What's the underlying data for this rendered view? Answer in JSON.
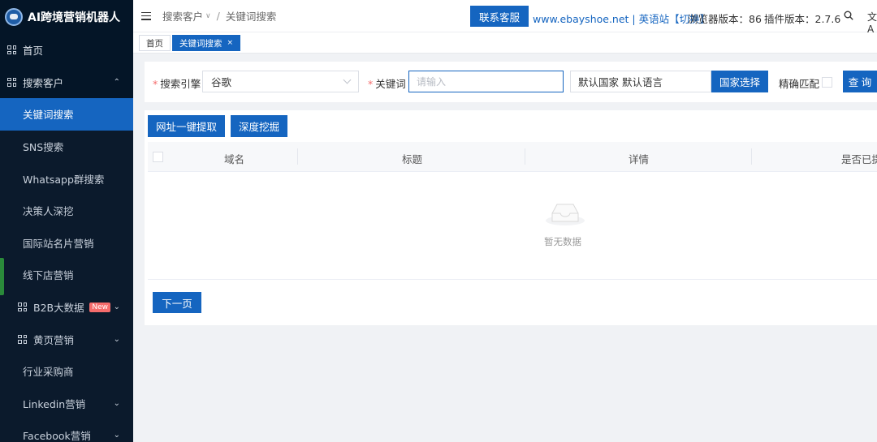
{
  "app": {
    "title": "AI跨境营销机器人"
  },
  "sidebar": {
    "items": [
      {
        "label": "首页",
        "icon": "grid-icon",
        "level": "top"
      },
      {
        "label": "搜索客户",
        "icon": "grid-icon",
        "level": "top",
        "expanded": true
      },
      {
        "label": "关键词搜索",
        "level": "sub",
        "active": true
      },
      {
        "label": "SNS搜索",
        "level": "sub"
      },
      {
        "label": "Whatsapp群搜索",
        "level": "sub"
      },
      {
        "label": "决策人深挖",
        "level": "sub"
      },
      {
        "label": "国际站名片营销",
        "level": "sub"
      },
      {
        "label": "线下店营销",
        "level": "sub"
      },
      {
        "label": "B2B大数据",
        "icon": "grid-icon",
        "level": "sub",
        "badge": "New"
      },
      {
        "label": "黄页营销",
        "icon": "grid-icon",
        "level": "sub"
      },
      {
        "label": "行业采购商",
        "level": "sub"
      },
      {
        "label": "Linkedin营销",
        "level": "sub"
      },
      {
        "label": "Facebook营销",
        "level": "sub"
      }
    ]
  },
  "header": {
    "breadcrumb": [
      "搜索客户",
      "关键词搜索"
    ],
    "contact_button": "联系客服",
    "site_link": "www.ebayshoe.net",
    "site_lang": "英语站【切换】",
    "browser_version": "浏览器版本：86",
    "plugin_version": "插件版本：2.7.6"
  },
  "tabs": [
    {
      "label": "首页",
      "active": false
    },
    {
      "label": "关键词搜索",
      "active": true
    }
  ],
  "search_form": {
    "engine_label": "搜索引擎",
    "engine_value": "谷歌",
    "keyword_label": "关键词",
    "keyword_placeholder": "请输入",
    "country_value": "默认国家 默认语言",
    "country_button": "国家选择",
    "exact_match_label": "精确匹配",
    "query_button": "查 询"
  },
  "actions": {
    "extract_button": "网址一键提取",
    "dig_button": "深度挖掘",
    "next_page_button": "下一页"
  },
  "table": {
    "columns": [
      "域名",
      "标题",
      "详情",
      "是否已提"
    ],
    "empty_text": "暂无数据"
  },
  "colors": {
    "primary": "#1565c0",
    "sidebar_bg": "#041527",
    "required": "#f56c6c"
  }
}
